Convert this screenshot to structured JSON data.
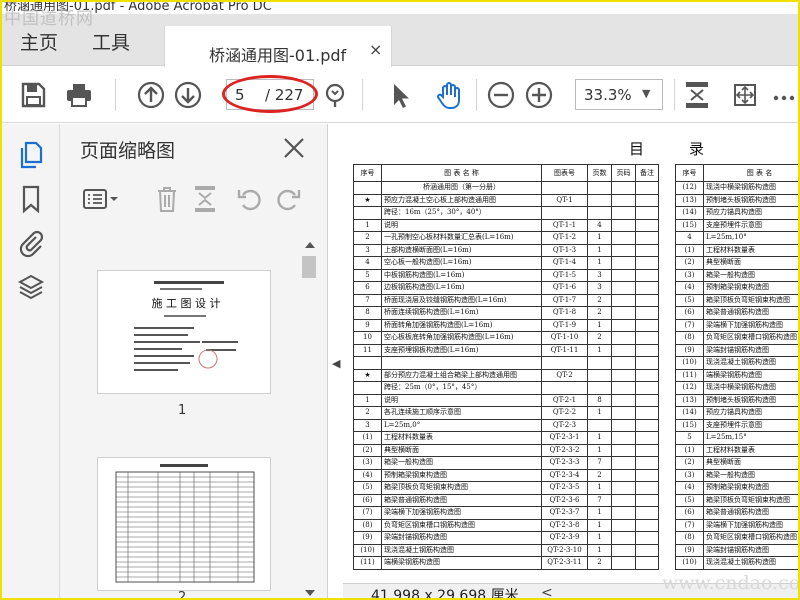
{
  "window": {
    "title": "桥涵通用图-01.pdf - Adobe Acrobat Pro DC"
  },
  "watermarks": {
    "top": "中国道桥网",
    "bottom": "www.cndao.com"
  },
  "menubar": {
    "home": "主页",
    "tools": "工具"
  },
  "tab": {
    "label": "桥涵通用图-01.pdf",
    "close": "×"
  },
  "toolbar": {
    "page_current": "5",
    "page_total": "/ 227",
    "zoom": "33.3%",
    "accent_color": "#1a6fd1",
    "highlight_color": "#dd2222"
  },
  "sidebar": {
    "panel_title": "页面缩略图",
    "rail_icons": [
      "copy-pages-icon",
      "bookmark-icon",
      "attachment-icon",
      "layers-icon"
    ]
  },
  "thumbnails": [
    {
      "label": "1",
      "title": "施 工 图 设 计"
    },
    {
      "label": "2"
    }
  ],
  "document": {
    "toc_title_left": "目",
    "toc_title_right": "录",
    "left_table": {
      "headers": [
        "序号",
        "图 表 名 称",
        "图表号",
        "页数",
        "页码",
        "备注"
      ],
      "rows": [
        [
          "",
          "桥涵通用图（第一分册）",
          "",
          "",
          "",
          ""
        ],
        [
          "★",
          "预应力混凝土空心板上部构造通用图",
          "QT-1",
          "",
          "",
          ""
        ],
        [
          "",
          "跨径：16m（25°，30°，40°）",
          "",
          "",
          "",
          ""
        ],
        [
          "1",
          "说明",
          "QT-1-1",
          "4",
          "",
          ""
        ],
        [
          "2",
          "一孔预制空心板材料数量汇总表(L=16m)",
          "QT-1-2",
          "1",
          "",
          ""
        ],
        [
          "3",
          "上部构造横断面图(L=16m)",
          "QT-1-3",
          "1",
          "",
          ""
        ],
        [
          "4",
          "空心板一般构造图(L=16m)",
          "QT-1-4",
          "1",
          "",
          ""
        ],
        [
          "5",
          "中板钢筋构造图(L=16m)",
          "QT-1-5",
          "3",
          "",
          ""
        ],
        [
          "6",
          "边板钢筋构造图(L=16m)",
          "QT-1-6",
          "3",
          "",
          ""
        ],
        [
          "7",
          "桥面现浇层及铰缝钢筋构造图(L=16m)",
          "QT-1-7",
          "2",
          "",
          ""
        ],
        [
          "8",
          "桥面连续钢筋构造图(L=16m)",
          "QT-1-8",
          "2",
          "",
          ""
        ],
        [
          "9",
          "桥面转角加强钢筋构造图(L=16m)",
          "QT-1-9",
          "1",
          "",
          ""
        ],
        [
          "10",
          "空心板板底转角加强钢筋构造图(L=16m)",
          "QT-1-10",
          "2",
          "",
          ""
        ],
        [
          "11",
          "支座预埋钢板构造图(L=16m)",
          "QT-1-11",
          "1",
          "",
          ""
        ],
        [
          "",
          "",
          "",
          "",
          "",
          ""
        ],
        [
          "★",
          "部分预应力混凝土组合箱梁上部构造通用图",
          "QT-2",
          "",
          "",
          ""
        ],
        [
          "",
          "跨径：25m（0°，15°，45°）",
          "",
          "",
          "",
          ""
        ],
        [
          "1",
          "说明",
          "QT-2-1",
          "8",
          "",
          ""
        ],
        [
          "2",
          "各孔连续施工顺序示意图",
          "QT-2-2",
          "1",
          "",
          ""
        ],
        [
          "3",
          "L=25m,0°",
          "QT-2-3",
          "",
          "",
          ""
        ],
        [
          "(1)",
          "工程材料数量表",
          "QT-2-3-1",
          "1",
          "",
          ""
        ],
        [
          "(2)",
          "典型横断面",
          "QT-2-3-2",
          "1",
          "",
          ""
        ],
        [
          "(3)",
          "箱梁一般构造图",
          "QT-2-3-3",
          "7",
          "",
          ""
        ],
        [
          "(4)",
          "预制箱梁钢束构造图",
          "QT-2-3-4",
          "2",
          "",
          ""
        ],
        [
          "(5)",
          "箱梁顶板负弯矩钢束构造图",
          "QT-2-3-5",
          "1",
          "",
          ""
        ],
        [
          "(6)",
          "箱梁普通钢筋构造图",
          "QT-2-3-6",
          "7",
          "",
          ""
        ],
        [
          "(7)",
          "梁端横下加强钢筋构造图",
          "QT-2-3-7",
          "1",
          "",
          ""
        ],
        [
          "(8)",
          "负弯矩区钢束槽口钢筋构造图",
          "QT-2-3-8",
          "1",
          "",
          ""
        ],
        [
          "(9)",
          "梁端封锚钢筋构造图",
          "QT-2-3-9",
          "1",
          "",
          ""
        ],
        [
          "(10)",
          "现浇混凝土钢筋构造图",
          "QT-2-3-10",
          "1",
          "",
          ""
        ],
        [
          "(11)",
          "端横梁钢筋构造图",
          "QT-2-3-11",
          "2",
          "",
          ""
        ]
      ]
    },
    "right_table": {
      "headers": [
        "序号",
        "图 表 名"
      ],
      "rows": [
        [
          "(12)",
          "现浇中横梁钢筋构造图"
        ],
        [
          "(13)",
          "预制堵头板钢筋构造图"
        ],
        [
          "(14)",
          "预应力锚具构造图"
        ],
        [
          "(15)",
          "支座预埋件示意图"
        ],
        [
          "4",
          "L=25m,10°"
        ],
        [
          "(1)",
          "工程材料数量表"
        ],
        [
          "(2)",
          "典型横断面"
        ],
        [
          "(3)",
          "箱梁一般构造图"
        ],
        [
          "(4)",
          "预制箱梁钢束构造图"
        ],
        [
          "(5)",
          "箱梁顶板负弯矩钢束构造图"
        ],
        [
          "(6)",
          "箱梁普通钢筋构造图"
        ],
        [
          "(7)",
          "梁端横下加强钢筋构造图"
        ],
        [
          "(8)",
          "负弯矩区钢束槽口钢筋构造图"
        ],
        [
          "(9)",
          "梁端封锚钢筋构造图"
        ],
        [
          "(10)",
          "现浇混凝土钢筋构造图"
        ],
        [
          "(11)",
          "端横梁钢筋构造图"
        ],
        [
          "(12)",
          "现浇中横梁钢筋构造图"
        ],
        [
          "(13)",
          "预制堵头板钢筋构造图"
        ],
        [
          "(14)",
          "预应力锚具构造图"
        ],
        [
          "(15)",
          "支座预埋件示意图"
        ],
        [
          "5",
          "L=25m,15°"
        ],
        [
          "(1)",
          "工程材料数量表"
        ],
        [
          "(2)",
          "典型横断面"
        ],
        [
          "(3)",
          "箱梁一般构造图"
        ],
        [
          "(4)",
          "预制箱梁钢束构造图"
        ],
        [
          "(5)",
          "箱梁顶板负弯矩钢束构造图"
        ],
        [
          "(6)",
          "箱梁普通钢筋构造图"
        ],
        [
          "(7)",
          "梁端横下加强钢筋构造图"
        ],
        [
          "(8)",
          "负弯矩区钢束槽口钢筋构造图"
        ],
        [
          "(9)",
          "梁端封锚钢筋构造图"
        ],
        [
          "(10)",
          "现浇混凝土钢筋构造图"
        ]
      ]
    }
  },
  "statusbar": {
    "dimensions": "41.998 x 29.698 厘米"
  }
}
